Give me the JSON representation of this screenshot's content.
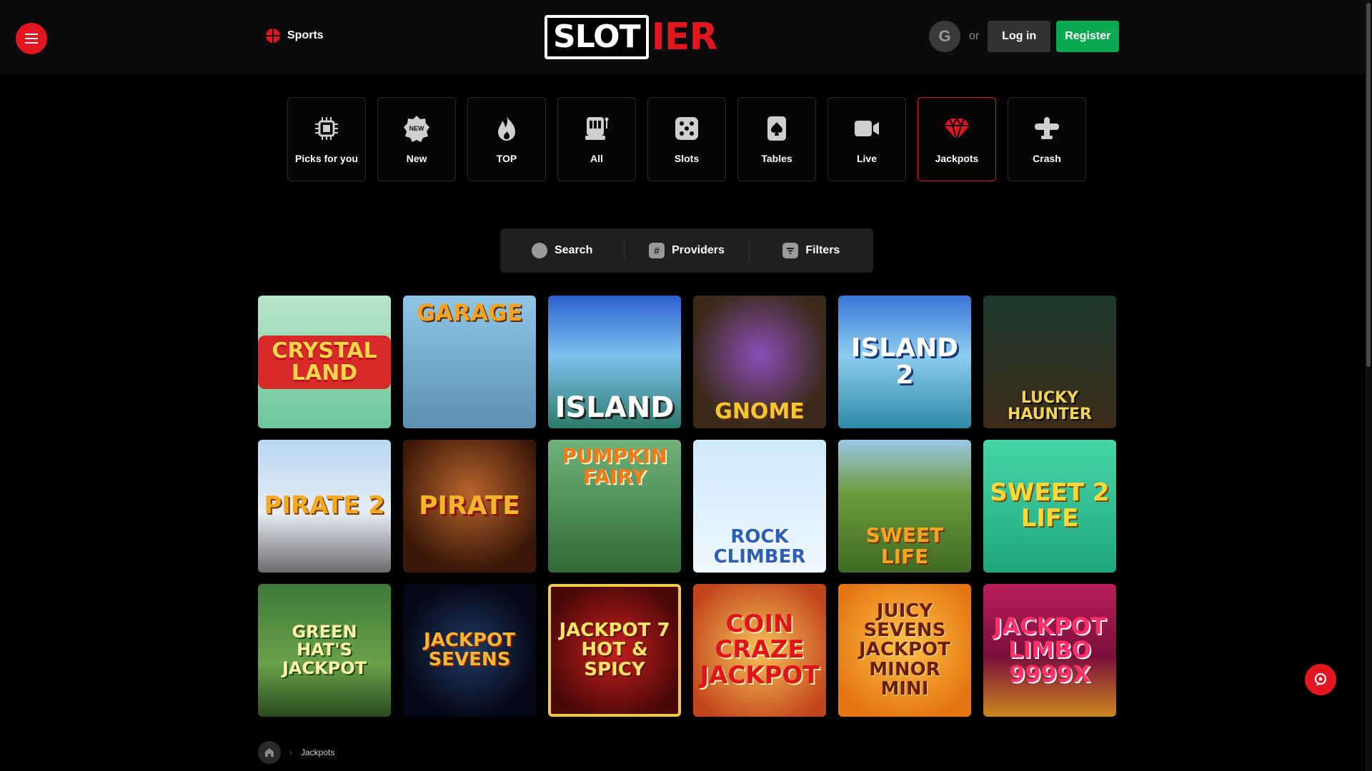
{
  "header": {
    "sports_label": "Sports",
    "logo_left": "SLOT",
    "logo_right": "IER",
    "google_letter": "G",
    "or_label": "or",
    "login_label": "Log in",
    "register_label": "Register"
  },
  "categories": [
    {
      "label": "Picks for you",
      "icon": "ai-chip-icon"
    },
    {
      "label": "New",
      "icon": "new-badge-icon",
      "badge": "NEW"
    },
    {
      "label": "TOP",
      "icon": "fire-icon"
    },
    {
      "label": "All",
      "icon": "slot-machine-icon"
    },
    {
      "label": "Slots",
      "icon": "dice-icon"
    },
    {
      "label": "Tables",
      "icon": "spade-card-icon"
    },
    {
      "label": "Live",
      "icon": "video-camera-icon"
    },
    {
      "label": "Jackpots",
      "icon": "gem-icon",
      "active": true
    },
    {
      "label": "Crash",
      "icon": "plane-icon"
    }
  ],
  "toolbar": {
    "search_label": "Search",
    "providers_label": "Providers",
    "providers_icon_glyph": "#",
    "filters_label": "Filters"
  },
  "games": [
    {
      "title": "CRYSTAL LAND"
    },
    {
      "title": "GARAGE"
    },
    {
      "title": "ISLAND"
    },
    {
      "title": "GNOME"
    },
    {
      "title": "ISLAND 2"
    },
    {
      "title": "LUCKY HAUNTER"
    },
    {
      "title": "PIRATE 2"
    },
    {
      "title": "PIRATE"
    },
    {
      "title": "PUMPKIN FAIRY"
    },
    {
      "title": "ROCK CLIMBER"
    },
    {
      "title": "SWEET LIFE"
    },
    {
      "title": "SWEET 2 LIFE"
    },
    {
      "title": "Green Hat's JACKPOT"
    },
    {
      "title": "JACKPOT SEVENS"
    },
    {
      "title": "JACKPOT 7 HOT & SPICY"
    },
    {
      "title": "COIN CRAZE JACKPOT"
    },
    {
      "title": "JUICY Sevens JACKPOT MINOR MINI"
    },
    {
      "title": "JACKPOT LIMBO 9999x"
    }
  ],
  "breadcrumb": {
    "current": "Jackpots"
  },
  "colors": {
    "brand_red": "#e3161f",
    "register_green": "#0aa84f",
    "background": "#000000"
  }
}
